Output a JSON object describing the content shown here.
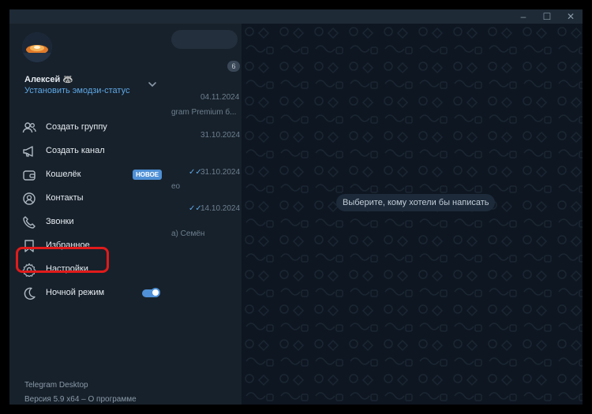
{
  "window": {
    "controls": [
      "–",
      "☐",
      "✕"
    ]
  },
  "user": {
    "name": "Алексей 🦝",
    "status_link": "Установить эмодзи-статус"
  },
  "menu": [
    {
      "id": "create-group",
      "label": "Создать группу",
      "icon": "users-icon"
    },
    {
      "id": "create-channel",
      "label": "Создать канал",
      "icon": "megaphone-icon"
    },
    {
      "id": "wallet",
      "label": "Кошелёк",
      "icon": "wallet-icon",
      "badge": "НОВОЕ"
    },
    {
      "id": "contacts",
      "label": "Контакты",
      "icon": "contact-icon"
    },
    {
      "id": "calls",
      "label": "Звонки",
      "icon": "phone-icon"
    },
    {
      "id": "saved",
      "label": "Избранное",
      "icon": "bookmark-icon"
    },
    {
      "id": "settings",
      "label": "Настройки",
      "icon": "gear-icon"
    },
    {
      "id": "night-mode",
      "label": "Ночной режим",
      "icon": "moon-icon",
      "toggle": true
    }
  ],
  "chatlist": {
    "unread_count": "6",
    "items": [
      {
        "date": "04.11.2024",
        "preview": "gram Premium б..."
      },
      {
        "date": "31.10.2024",
        "preview": ""
      },
      {
        "date": "31.10.2024",
        "preview": "eo",
        "read": true
      },
      {
        "date": "14.10.2024",
        "preview": "а) Семён",
        "read": true
      }
    ]
  },
  "chat": {
    "placeholder": "Выберите, кому хотели бы написать"
  },
  "footer": {
    "app_name": "Telegram Desktop",
    "version": "Версия 5.9 x64 – О программе"
  },
  "colors": {
    "accent": "#4f90d6",
    "highlight": "#e11b1b",
    "drawer_bg": "#17212b",
    "chat_bg": "#0e1621"
  }
}
